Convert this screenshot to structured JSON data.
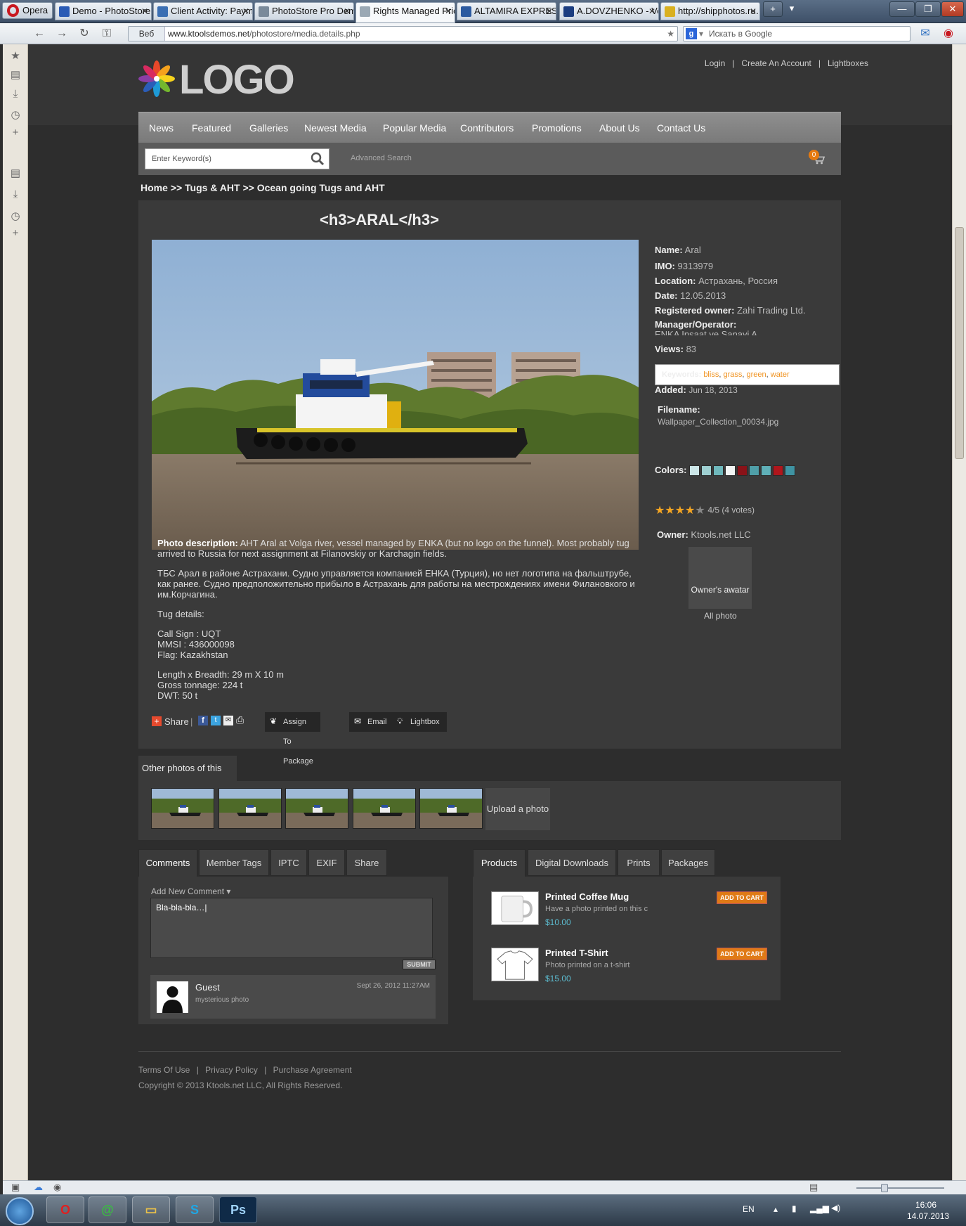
{
  "browser": {
    "menu_label": "Opera",
    "tabs": [
      {
        "label": "Demo - PhotoStore",
        "color": "#2a5bb5"
      },
      {
        "label": "Client Activity: Paym…",
        "color": "#3b6fb3"
      },
      {
        "label": "PhotoStore Pro Demo",
        "color": "#7a8a9a"
      },
      {
        "label": "Rights Managed Pric…",
        "color": "#9aa8b4"
      },
      {
        "label": "ALTAMIRA EXPRESS …",
        "color": "#2b5aa0"
      },
      {
        "label": "A.DOVZHENKO - Ve…",
        "color": "#1b3d80"
      },
      {
        "label": "http://shipphotos.ru…",
        "color": "#d9b020"
      }
    ],
    "address_tag": "Веб",
    "url_domain": "www.ktoolsdemos.net",
    "url_path": "/photostore/media.details.php",
    "search_placeholder": "Искать в Google"
  },
  "site": {
    "logo_text": "LOGO",
    "toplinks": {
      "login": "Login",
      "create": "Create An Account",
      "lightboxes": "Lightboxes",
      "sep": "|"
    },
    "nav": [
      "News",
      "Featured",
      "Galleries",
      "Newest Media",
      "Popular Media",
      "Contributors",
      "Promotions",
      "About Us",
      "Contact Us"
    ],
    "keyword_placeholder": "Enter Keyword(s)",
    "advanced_search": "Advanced Search",
    "cart_count": "0",
    "breadcrumb": "Home >> Tugs & AHT >> Ocean going Tugs and AHT",
    "title": "<h3>ARAL</h3>"
  },
  "description": {
    "label": "Photo description:",
    "text_en": "AHT Aral at Volga river, vessel managed by ENKA (but no logo on the funnel). Most probably tug arrived to Russia for next assignment at Filanovskiy or Karchagin fields.",
    "text_ru": " ТБС Арал в районе Астрахани. Судно управляется компанией ЕНКА (Турция), но нет логотипа на фальштрубе, как ранее. Судно предположительно прибыло в Астрахань для работы на местрождениях имени Филановкого и им.Корчагина.",
    "tug_details": " Tug details:",
    "call_sign": " Call Sign : UQT",
    "mmsi": " MMSI : 436000098",
    "flag": " Flag: Kazakhstan",
    "length": " Length x Breadth: 29 m X 10 m",
    "gross": " Gross tonnage: 224 t",
    "dwt": " DWT: 50 t"
  },
  "meta": {
    "name_k": "Name:",
    "name_v": "Aral",
    "imo_k": "IMO:",
    "imo_v": "9313979",
    "loc_k": "Location:",
    "loc_v": "Астрахань, Россия",
    "date_k": "Date:",
    "date_v": "12.05.2013",
    "owner_k": "Registered owner:",
    "owner_v": "Zahi Trading Ltd.",
    "manager_k": "Manager/Operator:",
    "manager_v": "ENKA Insaat ve Sanayi A",
    "views_k": "Views:",
    "views_v": "83",
    "keywords_k": "Keywords:",
    "keywords": [
      "bliss",
      "grass",
      "green",
      "water"
    ],
    "added_k": "Added:",
    "added_v": "Jun 18, 2013",
    "filename_k": "Filename:",
    "filename_v": "Wallpaper_Collection_00034.jpg",
    "colors_k": "Colors:",
    "colors": [
      "#cce6e8",
      "#9fd0d2",
      "#6fb8bc",
      "#f2f5f4",
      "#8a1218",
      "#4f9fa8",
      "#5fb0b8",
      "#b0161c",
      "#3f93a2"
    ],
    "rating": 4,
    "rating_max": 5,
    "rating_text": "4/5 (4 votes)",
    "owner_label": "Owner:",
    "owner_name": "Ktools.net LLC",
    "avatar_text": "Owner's awatar",
    "all_photo": "All photo"
  },
  "actions": {
    "share": "Share",
    "sep": "|",
    "assign": "Assign To Package",
    "email": "Email",
    "lightbox": "Lightbox"
  },
  "other": {
    "tab": "Other photos of this ship",
    "upload": "Upload a photo"
  },
  "left_tabs": [
    "Comments",
    "Member Tags",
    "IPTC",
    "EXIF",
    "Share"
  ],
  "comments": {
    "add_new": "Add New Comment",
    "text": "Bla-bla-bla…|",
    "submit": "SUBMIT",
    "author": "Guest",
    "date": "Sept 26, 2012 11:27AM",
    "body": "mysterious photo"
  },
  "right_tabs": [
    "Products",
    "Digital Downloads",
    "Prints",
    "Packages"
  ],
  "products": [
    {
      "name": "Printed Coffee Mug",
      "desc": "Have a photo printed on this c",
      "price": "$10.00",
      "btn": "ADD TO CART"
    },
    {
      "name": "Printed T-Shirt",
      "desc": "Photo printed on a t-shirt",
      "price": "$15.00",
      "btn": "ADD TO CART"
    }
  ],
  "footer": {
    "terms": "Terms Of Use",
    "privacy": "Privacy Policy",
    "purchase": "Purchase Agreement",
    "sep": "|",
    "copyright": "Copyright © 2013 Ktools.net LLC, All Rights Reserved."
  },
  "taskbar": {
    "lang": "EN",
    "time": "16:06",
    "date": "14.07.2013",
    "skype": "S",
    "ps": "Ps"
  }
}
